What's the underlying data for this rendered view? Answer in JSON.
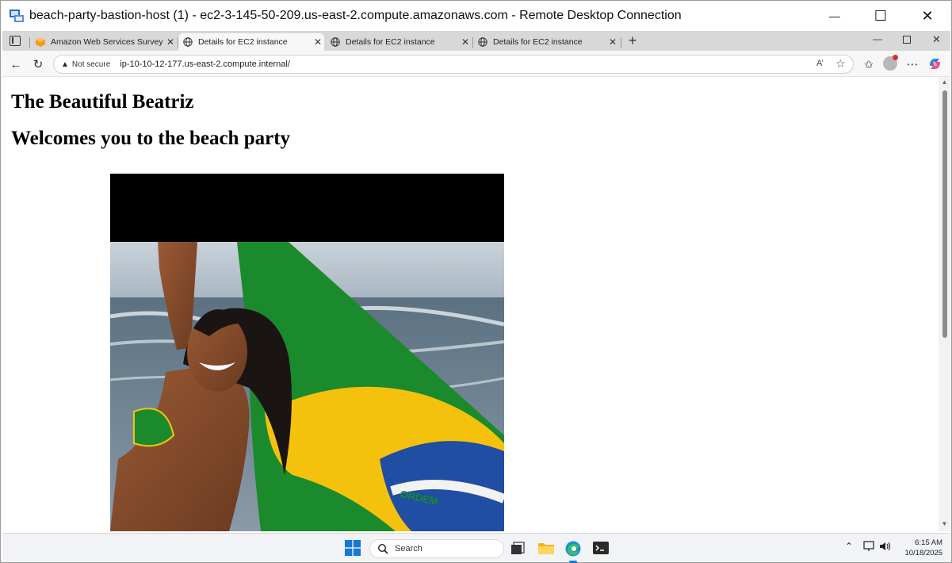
{
  "window": {
    "title": "beach-party-bastion-host (1) - ec2-3-145-50-209.us-east-2.compute.amazonaws.com - Remote Desktop Connection",
    "minimize": "—",
    "maximize": "☐",
    "close": "✕"
  },
  "browser": {
    "tabs": [
      {
        "label": "Amazon Web Services Survey",
        "icon": "aws-icon",
        "active": false
      },
      {
        "label": "Details for EC2 instance",
        "icon": "globe-icon",
        "active": true
      },
      {
        "label": "Details for EC2 instance",
        "icon": "globe-icon",
        "active": false
      },
      {
        "label": "Details for EC2 instance",
        "icon": "globe-icon",
        "active": false
      }
    ],
    "tab_close": "✕",
    "new_tab": "+",
    "address": {
      "security_label": "Not secure",
      "url": "ip-10-10-12-177.us-east-2.compute.internal/"
    }
  },
  "page": {
    "heading1": "The Beautiful Beatriz",
    "heading2": "Welcomes you to the beach party",
    "image_alt": "woman on beach with Brazilian flag"
  },
  "taskbar": {
    "search_label": "Search",
    "time": "6:15 AM",
    "date": "10/18/2025"
  }
}
